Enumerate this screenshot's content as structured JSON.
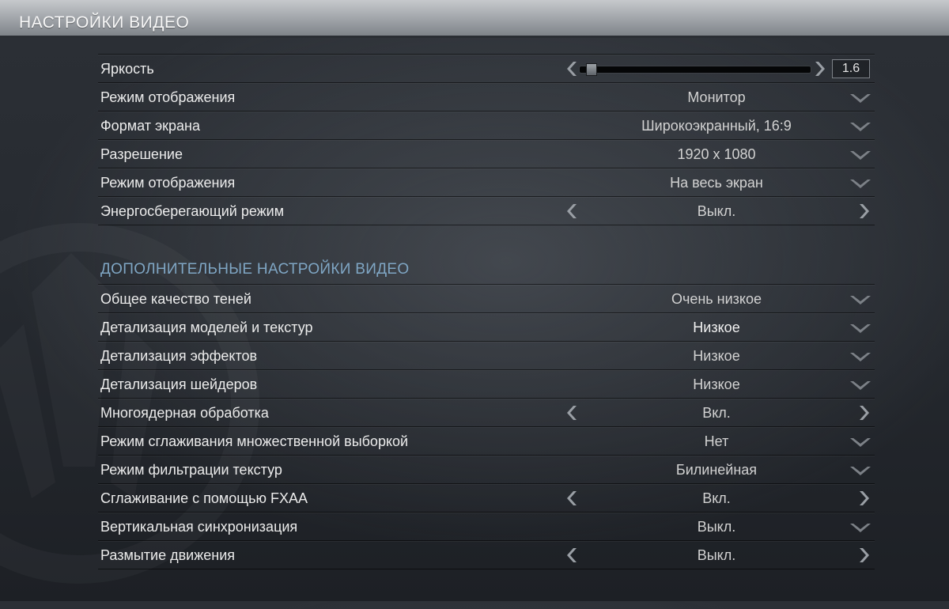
{
  "window": {
    "title": "НАСТРОЙКИ ВИДЕО"
  },
  "video": {
    "rows": [
      {
        "label": "Яркость",
        "control": "slider",
        "value_text": "1.6",
        "fill_fraction": 0.03
      },
      {
        "label": "Режим отображения",
        "control": "dropdown",
        "value": "Монитор"
      },
      {
        "label": "Формат экрана",
        "control": "dropdown",
        "value": "Широкоэкранный, 16:9"
      },
      {
        "label": "Разрешение",
        "control": "dropdown",
        "value": "1920 x 1080"
      },
      {
        "label": "Режим отображения",
        "control": "dropdown",
        "value": "На весь экран"
      },
      {
        "label": "Энергосберегающий режим",
        "control": "toggle",
        "value": "Выкл."
      }
    ]
  },
  "advanced": {
    "title": "ДОПОЛНИТЕЛЬНЫЕ НАСТРОЙКИ ВИДЕО",
    "rows": [
      {
        "label": "Общее качество теней",
        "control": "dropdown",
        "value": "Очень низкое"
      },
      {
        "label": "Детализация моделей и текстур",
        "control": "dropdown",
        "value": "Низкое"
      },
      {
        "label": "Детализация эффектов",
        "control": "dropdown",
        "value": "Низкое"
      },
      {
        "label": "Детализация шейдеров",
        "control": "dropdown",
        "value": "Низкое"
      },
      {
        "label": "Многоядерная обработка",
        "control": "toggle",
        "value": "Вкл."
      },
      {
        "label": "Режим сглаживания множественной выборкой",
        "control": "dropdown",
        "value": "Нет"
      },
      {
        "label": "Режим фильтрации текстур",
        "control": "dropdown",
        "value": "Билинейная"
      },
      {
        "label": "Сглаживание с помощью FXAA",
        "control": "toggle",
        "value": "Вкл."
      },
      {
        "label": "Вертикальная синхронизация",
        "control": "dropdown",
        "value": "Выкл."
      },
      {
        "label": "Размытие движения",
        "control": "toggle",
        "value": "Выкл."
      }
    ]
  },
  "icons": {
    "dropdown": "chevron-down-icon",
    "prev": "chevron-left-icon",
    "next": "chevron-right-icon",
    "background": "emblem-watermark-icon"
  },
  "colors": {
    "section_header": "#7fa6c4",
    "title_bar": "#9fa3a8",
    "background": "#262a30"
  }
}
